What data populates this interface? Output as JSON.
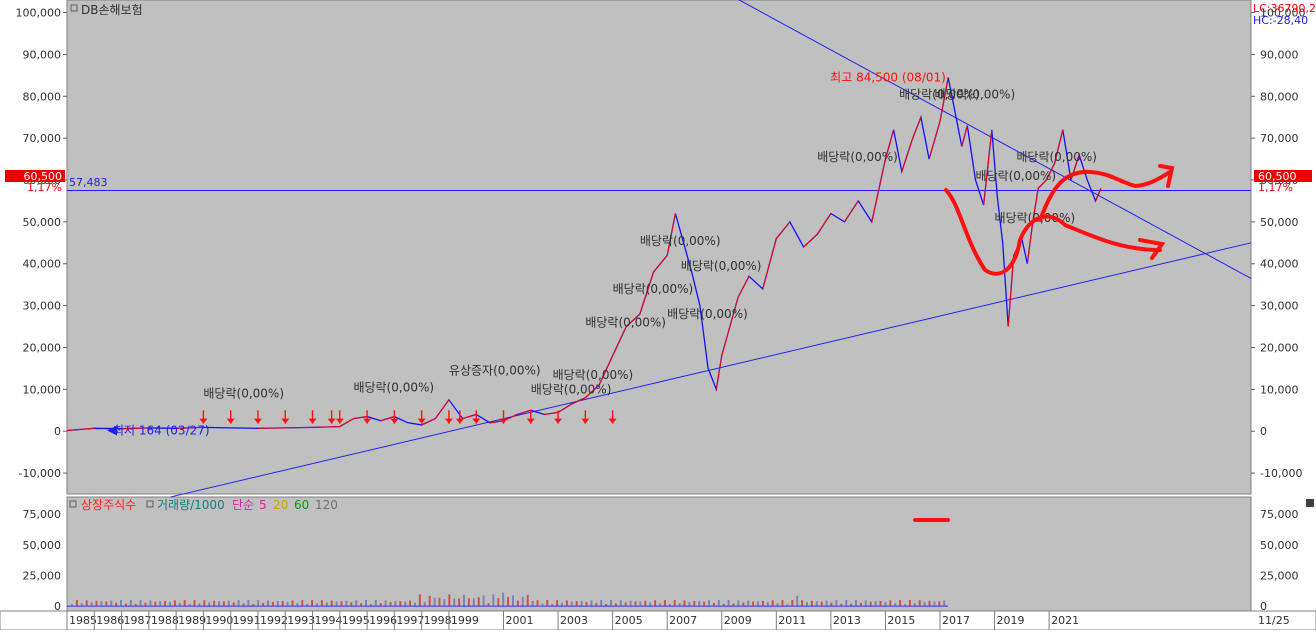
{
  "app": {
    "title": "DB손해보험",
    "lc_readout": "LC:36790,24",
    "hc_readout": "HC:-28,40",
    "current_price_badge": "60,500",
    "current_pct": "1,17%",
    "hline_label": "57,483",
    "date_corner": "11/25"
  },
  "colors": {
    "plot_bg": "#c0c0c0",
    "axis_bg": "#ffffff",
    "price_line": "#1010ff",
    "price_up": "#ff0000",
    "trendline": "#2020ee",
    "annotation_red": "#ff1010",
    "label_text": "#303030"
  },
  "chart_data": [
    {
      "type": "line",
      "title": "DB손해보험",
      "ylim": [
        -15000,
        103000
      ],
      "yticks": [
        100000,
        90000,
        80000,
        70000,
        60000,
        50000,
        40000,
        30000,
        20000,
        10000,
        0,
        -10000
      ],
      "ytick_labels": [
        "100,000",
        "90,000",
        "80,000",
        "70,000",
        "60,000",
        "50,000",
        "40,000",
        "30,000",
        "20,000",
        "10,000",
        "0",
        "-10,000"
      ],
      "xlim": [
        1985.0,
        2028.4
      ],
      "xticks": [
        1985,
        1986,
        1987,
        1988,
        1989,
        1990,
        1991,
        1992,
        1993,
        1994,
        1995,
        1996,
        1997,
        1998,
        1999,
        2001,
        2003,
        2005,
        2007,
        2009,
        2011,
        2013,
        2015,
        2017,
        2019,
        2021
      ],
      "xtick_labels": [
        "1985",
        "1986",
        "1987",
        "1988",
        "1989",
        "1990",
        "1991",
        "1992",
        "1993",
        "1994",
        "1995",
        "1996",
        "1997",
        "1998",
        "1999",
        "2001",
        "2003",
        "2005",
        "2007",
        "2009",
        "2011",
        "2013",
        "2015",
        "2017",
        "2019",
        "2021"
      ],
      "series": [
        {
          "x": [
            1985.0,
            1986.0,
            1987.0,
            1988.0,
            1989.0,
            1990.0,
            1991.0,
            1992.0,
            1993.0,
            1994.0,
            1995.0,
            1995.5,
            1996.0,
            1996.5,
            1997.0,
            1997.5,
            1998.0,
            1998.5,
            1999.0,
            1999.5,
            2000.0,
            2000.5,
            2001.0,
            2001.5,
            2002.0,
            2002.5,
            2003.0,
            2003.5,
            2004.0,
            2004.5,
            2005.0,
            2005.5,
            2006.0,
            2006.5,
            2007.0,
            2007.3,
            2007.6,
            2007.9,
            2008.2,
            2008.5,
            2008.8,
            2009.0,
            2009.3,
            2009.6,
            2010.0,
            2010.5,
            2011.0,
            2011.5,
            2012.0,
            2012.5,
            2013.0,
            2013.5,
            2014.0,
            2014.5,
            2015.0,
            2015.3,
            2015.6,
            2016.0,
            2016.3,
            2016.6,
            2017.0,
            2017.3,
            2017.5,
            2017.8,
            2018.0,
            2018.3,
            2018.6,
            2018.9,
            2019.1,
            2019.3,
            2019.5,
            2019.7,
            2020.0,
            2020.2,
            2020.4,
            2020.6,
            2020.9,
            2021.2,
            2021.5,
            2021.8,
            2022.1,
            2022.4,
            2022.7,
            2022.9
          ],
          "y": [
            164,
            700,
            600,
            800,
            700,
            900,
            800,
            700,
            800,
            900,
            1100,
            3000,
            3500,
            2500,
            3500,
            2000,
            1500,
            3000,
            7500,
            3000,
            4000,
            2000,
            2500,
            4000,
            5000,
            4000,
            4500,
            6500,
            8000,
            11000,
            18000,
            25000,
            28000,
            38000,
            42000,
            52000,
            45000,
            38000,
            30000,
            15000,
            10000,
            18000,
            25000,
            32000,
            37000,
            34000,
            46000,
            50000,
            44000,
            47000,
            52000,
            50000,
            55000,
            50000,
            65000,
            72000,
            62000,
            70000,
            75000,
            65000,
            74000,
            84500,
            78000,
            68000,
            73000,
            60000,
            54000,
            72000,
            56000,
            45000,
            25000,
            42000,
            46000,
            40000,
            50000,
            58000,
            60000,
            64000,
            72000,
            60000,
            66000,
            60000,
            55000,
            58000
          ]
        }
      ],
      "hline": 57483,
      "annotations": [
        {
          "text": "최고 84,500 (08/01)",
          "x": 2017.3,
          "y": 84500
        },
        {
          "text": "최저 164 (03/27)",
          "x": 1985.0,
          "y": 164
        },
        {
          "text": "배당락(0,00%)",
          "x": 1990.0,
          "y": 8000
        },
        {
          "text": "배당락(0,00%)",
          "x": 1995.5,
          "y": 9500
        },
        {
          "text": "유상증자(0,00%)",
          "x": 1999.0,
          "y": 13500
        },
        {
          "text": "배당락(0,00%)",
          "x": 2002.8,
          "y": 12500
        },
        {
          "text": "배당락(0,00%)",
          "x": 2002.0,
          "y": 9000
        },
        {
          "text": "배당락(0,00%)",
          "x": 2004.0,
          "y": 25000
        },
        {
          "text": "배당락(0,00%)",
          "x": 2005.0,
          "y": 33000
        },
        {
          "text": "배당락(0,00%)",
          "x": 2006.0,
          "y": 44500
        },
        {
          "text": "배당락(0,00%)",
          "x": 2007.5,
          "y": 38500
        },
        {
          "text": "배당락(0,00%)",
          "x": 2007.0,
          "y": 27000
        },
        {
          "text": "배당락(0,00%)",
          "x": 2012.5,
          "y": 64500
        },
        {
          "text": "배당락(0,00%)",
          "x": 2015.5,
          "y": 79500
        },
        {
          "text": "배당락(0,00%)",
          "x": 2016.8,
          "y": 79500
        },
        {
          "text": "배당락(0,00%)",
          "x": 2018.3,
          "y": 60000
        },
        {
          "text": "배당락(0,00%)",
          "x": 2019.8,
          "y": 64500
        },
        {
          "text": "배당락(0,00%)",
          "x": 2019.0,
          "y": 50000
        }
      ]
    },
    {
      "type": "bar",
      "ylim": [
        -4000,
        89000
      ],
      "yticks": [
        75000,
        50000,
        25000,
        0
      ],
      "ytick_labels": [
        "75,000",
        "50,000",
        "25,000",
        "0"
      ],
      "legend": [
        "상장주식수",
        "거래량/1000",
        "단순",
        "5",
        "20",
        "60",
        "120"
      ]
    }
  ]
}
